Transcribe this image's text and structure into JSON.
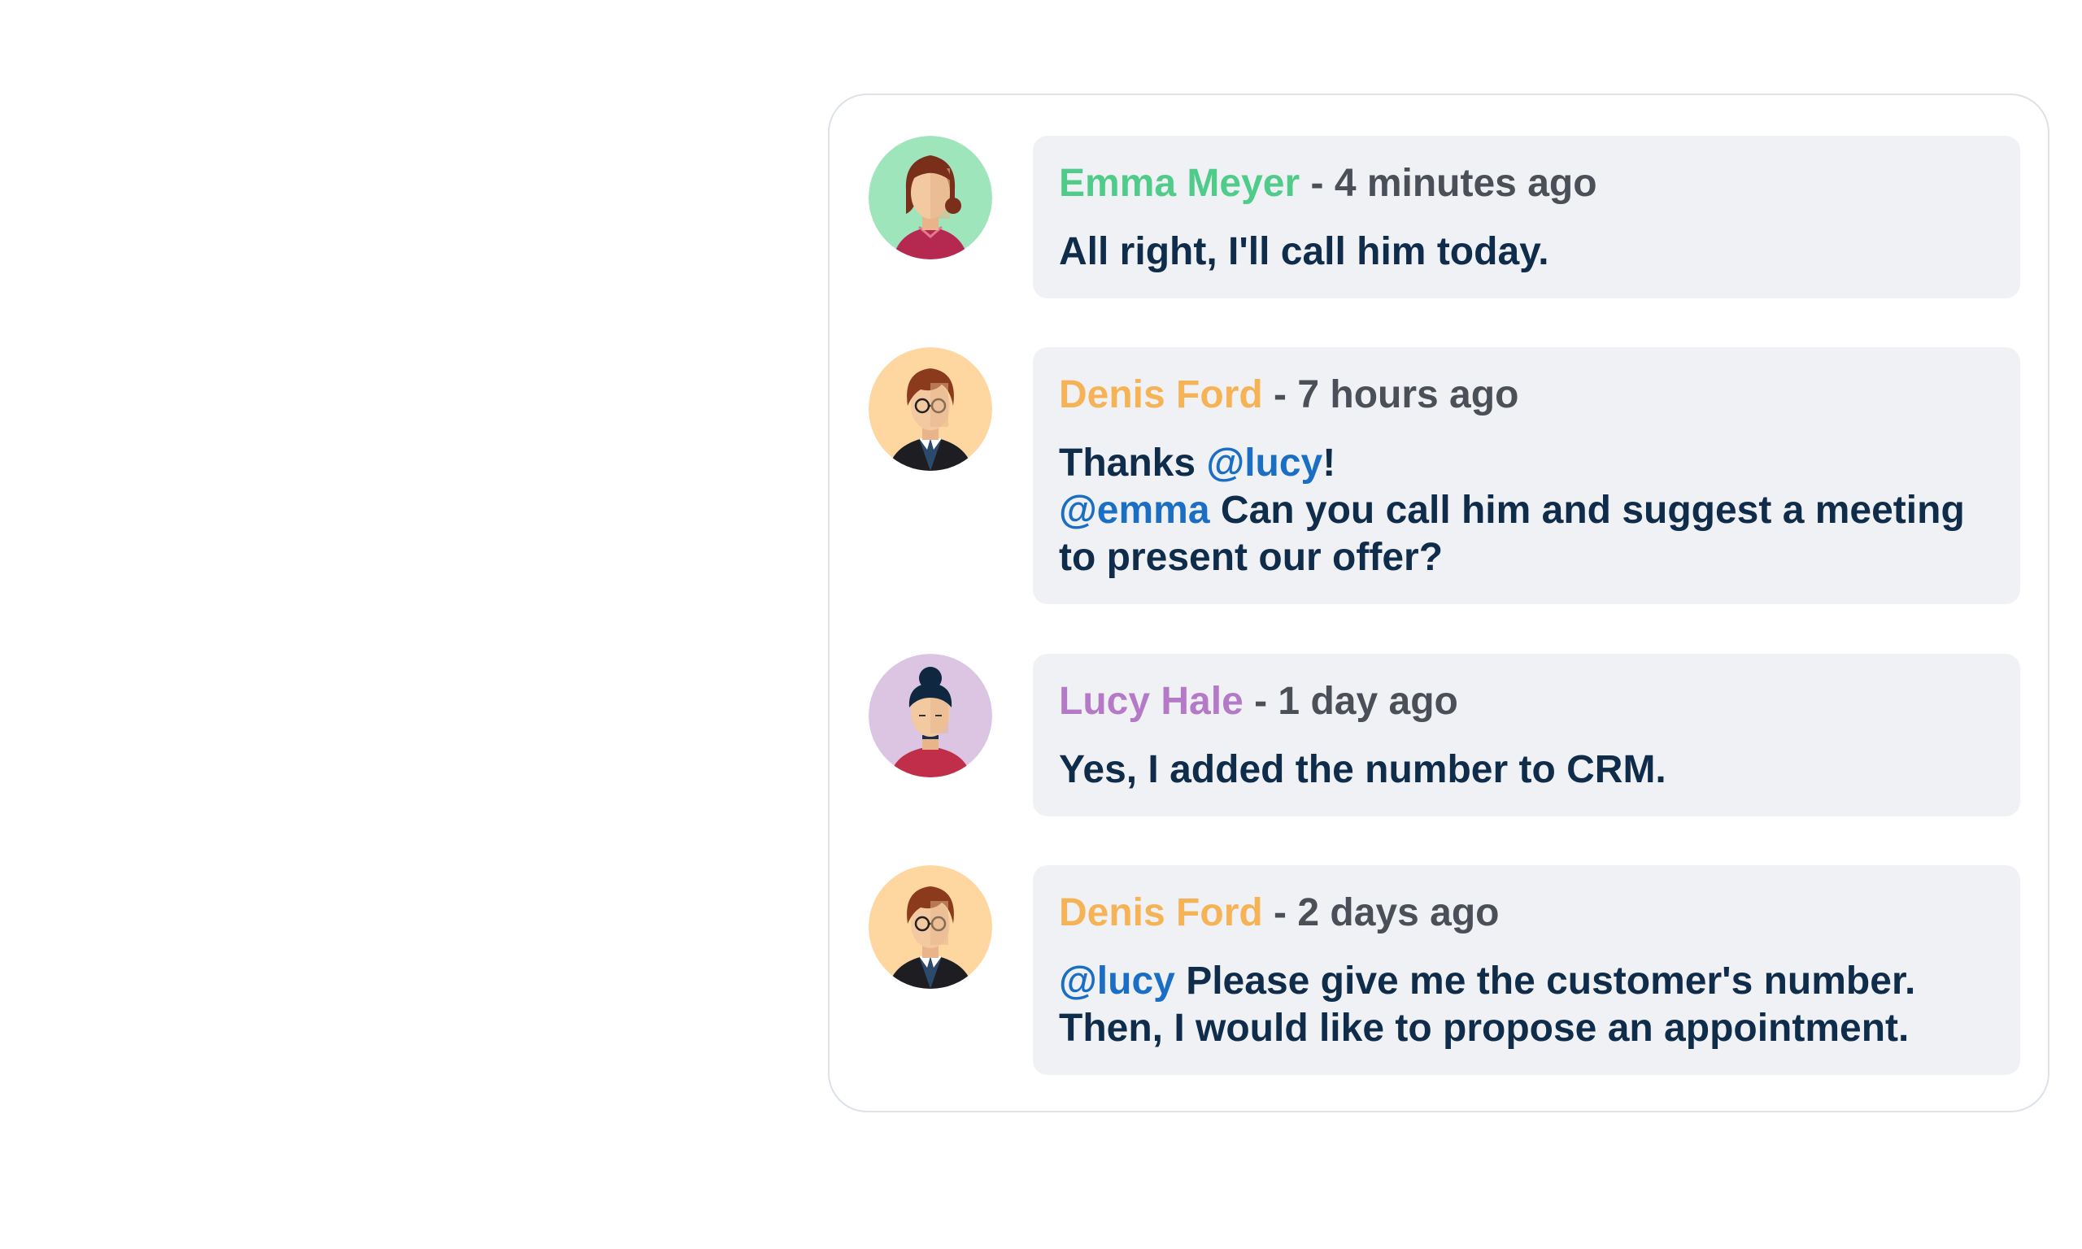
{
  "comments": [
    {
      "author": "Emma Meyer",
      "author_color": "#4fcb8a",
      "separator": " - ",
      "time": "4 minutes ago",
      "avatar": {
        "icon": "woman-brown-hair-avatar-icon",
        "bg": "#9fe5bc"
      },
      "lines": [
        [
          {
            "text": "All right, I'll call him today."
          }
        ]
      ]
    },
    {
      "author": "Denis Ford",
      "author_color": "#f5b356",
      "separator": " - ",
      "time": "7 hours ago",
      "avatar": {
        "icon": "man-glasses-avatar-icon",
        "bg": "#fdd6a0"
      },
      "lines": [
        [
          {
            "text": "Thanks "
          },
          {
            "text": "@lucy",
            "mention": true
          },
          {
            "text": "!"
          }
        ],
        [
          {
            "text": "@emma",
            "mention": true
          },
          {
            "text": " Can you call him and suggest a meeting"
          }
        ],
        [
          {
            "text": "to present our offer?"
          }
        ]
      ]
    },
    {
      "author": "Lucy Hale",
      "author_color": "#b57ac7",
      "separator": " - ",
      "time": "1 day ago",
      "avatar": {
        "icon": "woman-hair-bun-avatar-icon",
        "bg": "#dcc5e3"
      },
      "lines": [
        [
          {
            "text": "Yes, I added the number to CRM."
          }
        ]
      ]
    },
    {
      "author": "Denis Ford",
      "author_color": "#f5b356",
      "separator": " - ",
      "time": "2 days ago",
      "avatar": {
        "icon": "man-glasses-avatar-icon",
        "bg": "#fdd6a0"
      },
      "lines": [
        [
          {
            "text": "@lucy",
            "mention": true
          },
          {
            "text": " Please give me the customer's number."
          }
        ],
        [
          {
            "text": "Then, I would like to propose an appointment."
          }
        ]
      ]
    }
  ]
}
